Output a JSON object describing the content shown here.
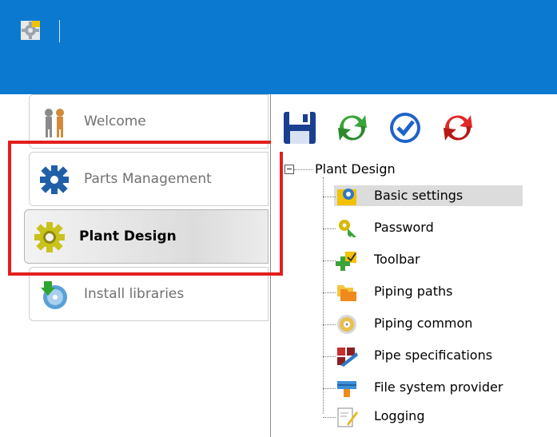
{
  "colors": {
    "titlebar": "#0b79d0",
    "highlight": "#e31e1e",
    "selected_bg": "#dcdcdc"
  },
  "titlebar": {
    "app_icon": "gear-app-icon"
  },
  "sidebar": {
    "tabs": [
      {
        "label": "Welcome",
        "icon": "welcome-people-icon",
        "active": false
      },
      {
        "label": "Parts Management",
        "icon": "gear-icon",
        "active": false
      },
      {
        "label": "Plant Design",
        "icon": "yellow-gear-icon",
        "active": true
      },
      {
        "label": "Install libraries",
        "icon": "install-disc-icon",
        "active": false
      }
    ]
  },
  "toolbar": {
    "buttons": [
      {
        "name": "save",
        "icon": "floppy-save-icon"
      },
      {
        "name": "refresh",
        "icon": "green-refresh-icon"
      },
      {
        "name": "apply",
        "icon": "blue-check-icon"
      },
      {
        "name": "reset",
        "icon": "red-refresh-icon"
      }
    ]
  },
  "tree": {
    "root": "Plant Design",
    "items": [
      {
        "label": "Basic settings",
        "icon": "basic-settings-icon",
        "selected": true
      },
      {
        "label": "Password",
        "icon": "key-icon",
        "selected": false
      },
      {
        "label": "Toolbar",
        "icon": "toolbar-plus-icon",
        "selected": false
      },
      {
        "label": "Piping paths",
        "icon": "folders-icon",
        "selected": false
      },
      {
        "label": "Piping common",
        "icon": "cd-gear-icon",
        "selected": false
      },
      {
        "label": "Pipe specifications",
        "icon": "pipe-spec-icon",
        "selected": false
      },
      {
        "label": "File system provider",
        "icon": "file-system-icon",
        "selected": false
      },
      {
        "label": "Logging",
        "icon": "log-document-icon",
        "selected": false
      }
    ]
  }
}
